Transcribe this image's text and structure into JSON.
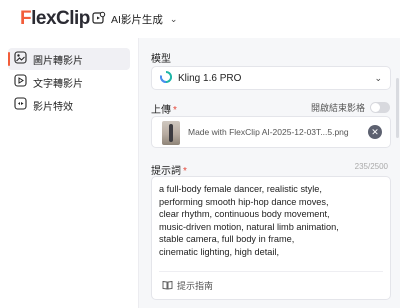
{
  "header": {
    "logo_text": "FlexClip",
    "mode_label": "AI影片生成"
  },
  "sidebar": {
    "items": [
      {
        "label": "圖片轉影片",
        "active": true
      },
      {
        "label": "文字轉影片",
        "active": false
      },
      {
        "label": "影片特效",
        "active": false
      }
    ]
  },
  "main": {
    "model_label": "模型",
    "model_value": "Kling 1.6 PRO",
    "upload_label": "上傳",
    "end_frame_label": "開啟結束影格",
    "end_frame_enabled": false,
    "upload_filename": "Made with FlexClip AI-2025-12-03T...5.png",
    "prompt_label": "提示詞",
    "prompt_counter": "235/2500",
    "prompt_text": "a full-body female dancer, realistic style,\nperforming smooth hip-hop dance moves,\nclear rhythm, continuous body movement,\nmusic-driven motion, natural limb animation,\nstable camera, full body in frame,\ncinematic lighting, high detail,",
    "guide_label": "提示指南"
  },
  "colors": {
    "brand": "#f25d3a",
    "required": "#e5473a",
    "model_icon": "#1fb6a8"
  }
}
